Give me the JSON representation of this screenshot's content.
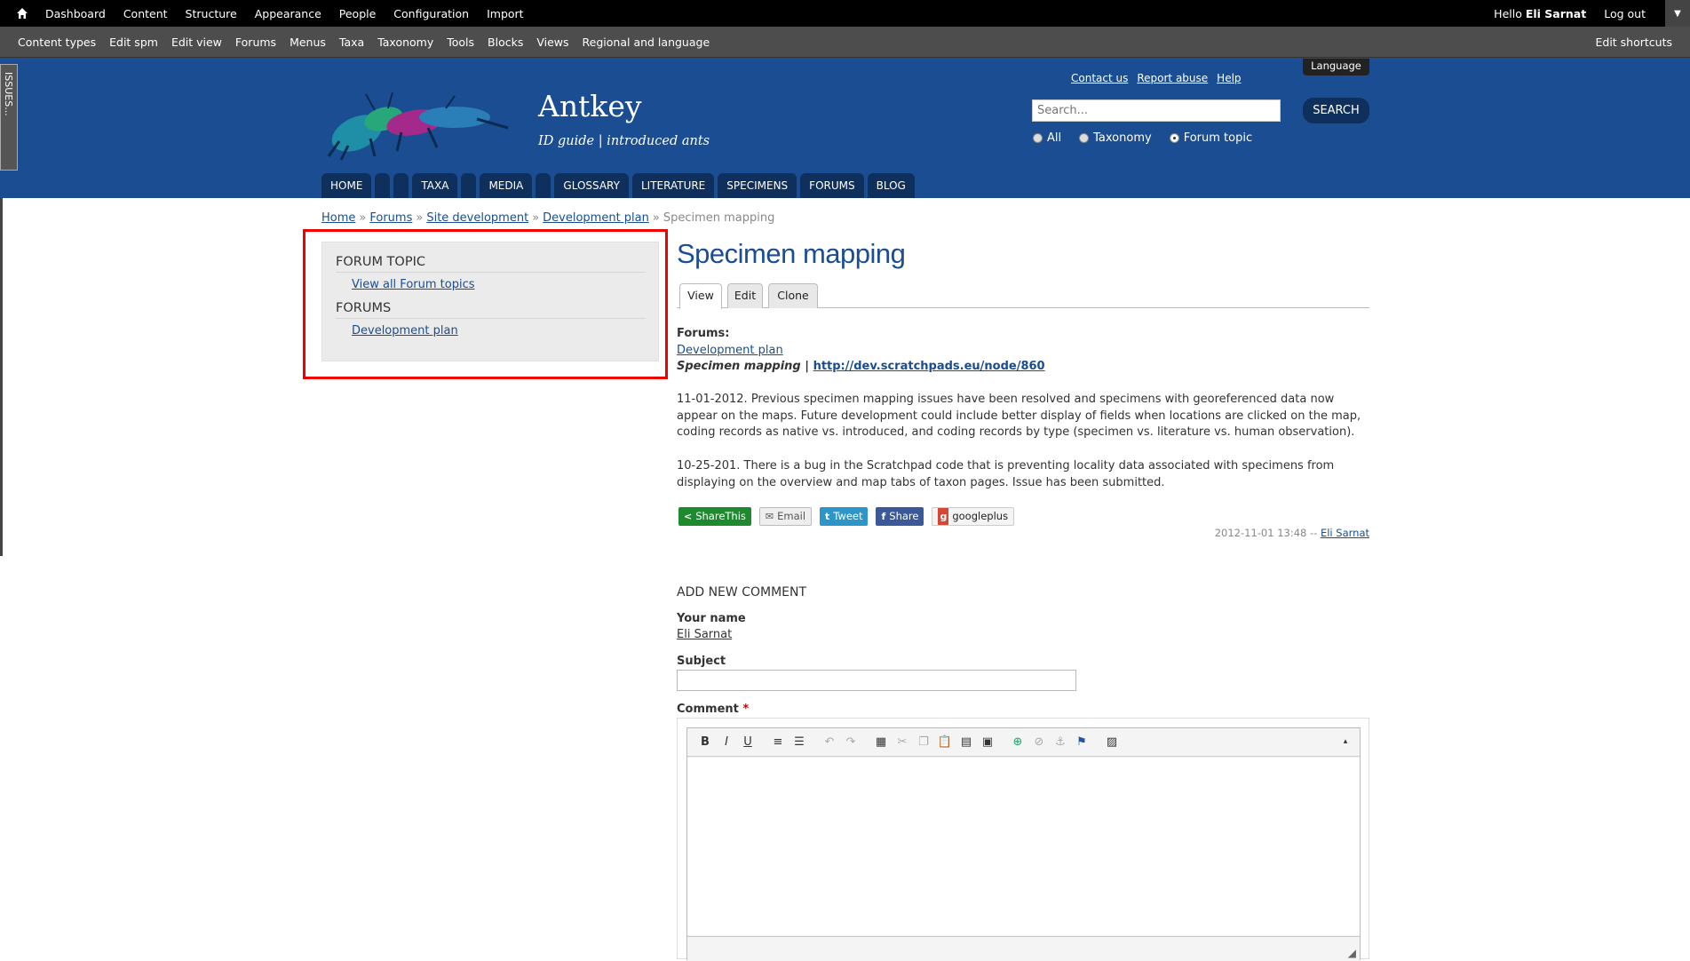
{
  "toolbar": {
    "items": [
      "Dashboard",
      "Content",
      "Structure",
      "Appearance",
      "People",
      "Configuration",
      "Import"
    ],
    "hello_prefix": "Hello",
    "user": "Eli Sarnat",
    "logout": "Log out"
  },
  "shortcuts": {
    "items": [
      "Content types",
      "Edit spm",
      "Edit view",
      "Forums",
      "Menus",
      "Taxa",
      "Taxonomy",
      "Tools",
      "Blocks",
      "Views",
      "Regional and language"
    ],
    "edit": "Edit shortcuts"
  },
  "issues_tab": "ISSUES...",
  "site": {
    "name": "Antkey",
    "slogan": "ID guide | introduced ants",
    "language": "Language"
  },
  "toplinks": [
    "Contact us",
    "Report abuse",
    "Help"
  ],
  "search": {
    "placeholder": "Search...",
    "button": "SEARCH",
    "options": [
      "All",
      "Taxonomy",
      "Forum topic"
    ],
    "selected": "Forum topic"
  },
  "nav": [
    "HOME",
    "",
    "",
    "TAXA",
    "",
    "MEDIA",
    "",
    "GLOSSARY",
    "LITERATURE",
    "SPECIMENS",
    "FORUMS",
    "BLOG"
  ],
  "breadcrumb": {
    "links": [
      "Home",
      "Forums",
      "Site development",
      "Development plan"
    ],
    "current": "Specimen mapping",
    "separator": "»"
  },
  "sidebar": {
    "forum_topic_heading": "FORUM TOPIC",
    "forum_topic_link": "View all Forum topics",
    "forums_heading": "FORUMS",
    "forums_link": "Development plan"
  },
  "page": {
    "title": "Specimen mapping",
    "tabs": [
      "View",
      "Edit",
      "Clone"
    ],
    "forums_label": "Forums:",
    "forums_link": "Development plan",
    "ref_title": "Specimen mapping",
    "ref_sep": " | ",
    "ref_url": "http://dev.scratchpads.eu/node/860",
    "para1": "11-01-2012. Previous specimen mapping issues have been resolved and specimens with georeferenced data now appear on the maps. Future development could include better display of fields when locations are clicked on the map, coding records as native vs. introduced, and coding records by type (specimen vs. literature vs. human observation).",
    "para2": "10-25-201. There is a bug in the Scratchpad code that is preventing locality data associated with specimens from displaying on the overview and map tabs of taxon pages. Issue has been submitted.",
    "meta_date": "2012-11-01 13:48 --",
    "meta_author": "Eli Sarnat"
  },
  "share": {
    "sharethis": "ShareThis",
    "email": "Email",
    "tweet": "Tweet",
    "share": "Share",
    "googleplus": "googleplus"
  },
  "comment": {
    "heading": "ADD NEW COMMENT",
    "name_label": "Your name",
    "name_value": "Eli Sarnat",
    "subject_label": "Subject",
    "comment_label": "Comment",
    "required_mark": "*"
  },
  "colors": {
    "header_blue": "#1b4d92",
    "nav_dark": "#0f2f5c",
    "highlight_red": "#e00000"
  }
}
